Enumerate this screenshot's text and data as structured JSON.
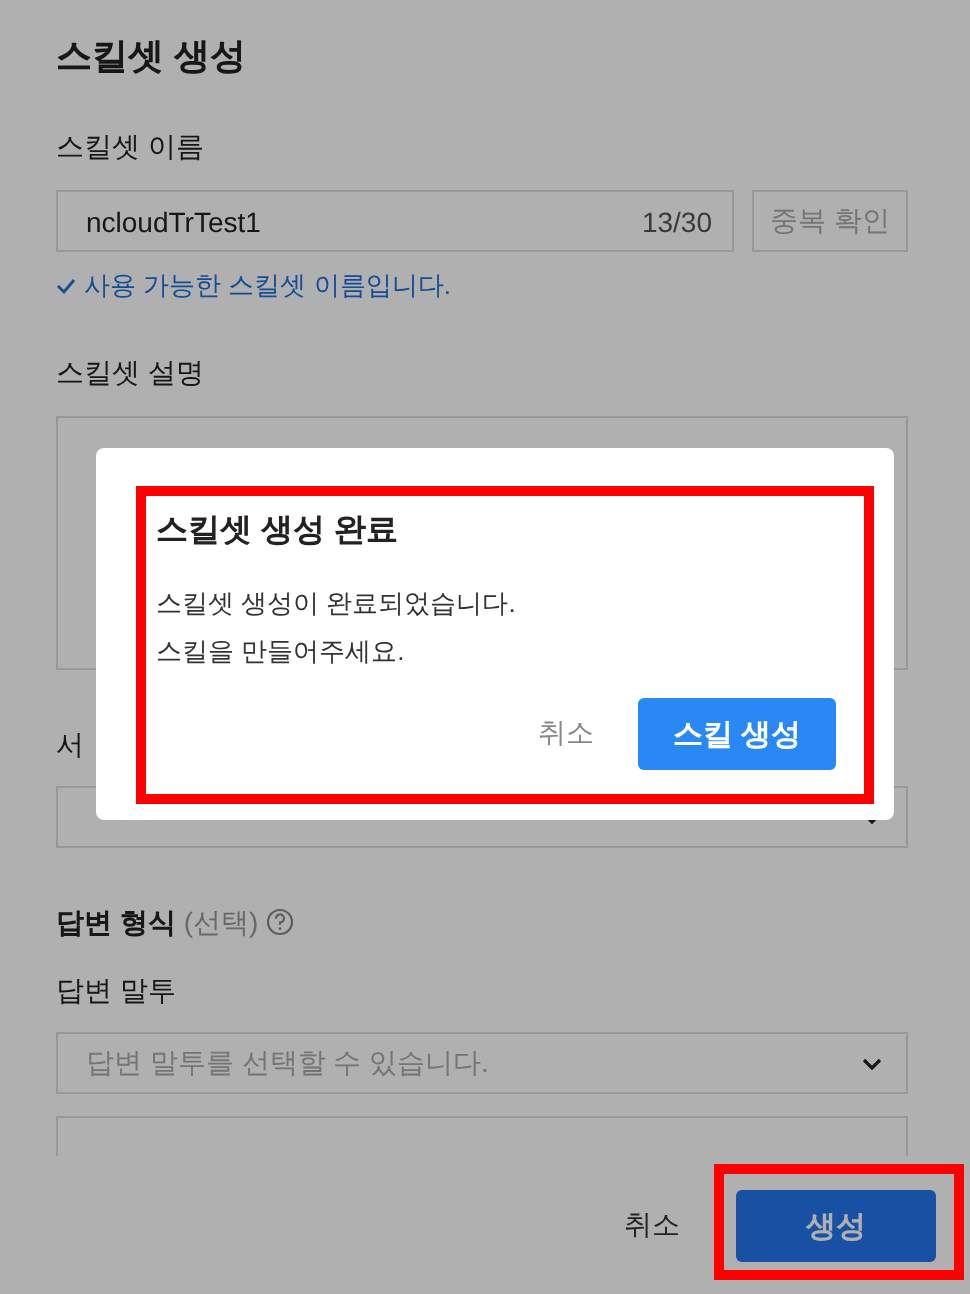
{
  "page": {
    "title": "스킬셋 생성"
  },
  "name_field": {
    "label": "스킬셋 이름",
    "value": "ncloudTrTest1",
    "counter": "13/30",
    "check_button": "중복 확인",
    "check_disabled": true,
    "validation": "사용 가능한 스킬셋 이름입니다.",
    "valid": true
  },
  "description_field": {
    "label": "스킬셋 설명"
  },
  "service_field": {
    "label": "서"
  },
  "answer_format": {
    "label": "답변 형식",
    "optional": "(선택)"
  },
  "tone_field": {
    "label": "답변 말투",
    "placeholder": "답변 말투를 선택할 수 있습니다."
  },
  "footer": {
    "cancel": "취소",
    "submit": "생성",
    "highlighted": true
  },
  "dialog": {
    "title": "스킬셋 생성 완료",
    "lines": [
      "스킬셋 생성이 완료되었습니다.",
      "스킬을 만들어주세요."
    ],
    "cancel": "취소",
    "confirm": "스킬 생성",
    "highlighted": true
  }
}
